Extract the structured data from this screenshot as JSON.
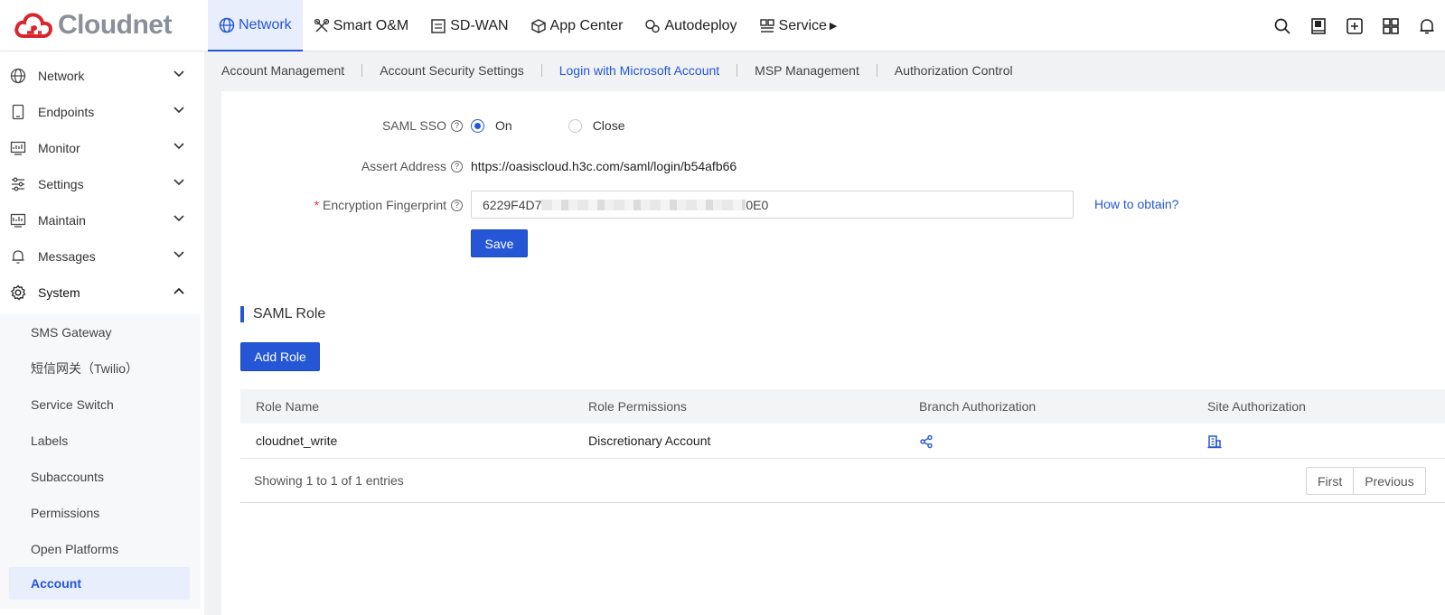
{
  "brand": {
    "name": "Cloudnet",
    "accent": "#2456d6",
    "logo_red": "#d8262d"
  },
  "topnav": {
    "items": [
      {
        "label": "Network",
        "icon": "globe-icon",
        "active": true
      },
      {
        "label": "Smart O&M",
        "icon": "tools-icon"
      },
      {
        "label": "SD-WAN",
        "icon": "sdwan-icon"
      },
      {
        "label": "App Center",
        "icon": "cube-icon"
      },
      {
        "label": "Autodeploy",
        "icon": "gears-icon"
      },
      {
        "label": "Service",
        "icon": "service-icon"
      }
    ],
    "right_icons": [
      "search-icon",
      "book-icon",
      "plus-box-icon",
      "grid-icon",
      "bell-icon"
    ]
  },
  "sidebar": {
    "items": [
      {
        "label": "Network",
        "icon": "globe-icon"
      },
      {
        "label": "Endpoints",
        "icon": "tablet-icon"
      },
      {
        "label": "Monitor",
        "icon": "monitor-icon"
      },
      {
        "label": "Settings",
        "icon": "sliders-icon"
      },
      {
        "label": "Maintain",
        "icon": "maintain-icon"
      },
      {
        "label": "Messages",
        "icon": "bell-icon"
      },
      {
        "label": "System",
        "icon": "gear-icon",
        "open": true
      }
    ],
    "sub_items": [
      {
        "label": "SMS Gateway"
      },
      {
        "label": "短信网关（Twilio）"
      },
      {
        "label": "Service Switch"
      },
      {
        "label": "Labels"
      },
      {
        "label": "Subaccounts"
      },
      {
        "label": "Permissions"
      },
      {
        "label": "Open Platforms"
      },
      {
        "label": "Account",
        "active": true
      }
    ]
  },
  "tabs": [
    {
      "label": "Account Management"
    },
    {
      "label": "Account Security Settings"
    },
    {
      "label": "Login with Microsoft Account",
      "active": true
    },
    {
      "label": "MSP Management"
    },
    {
      "label": "Authorization Control"
    }
  ],
  "form": {
    "saml_sso_label": "SAML SSO",
    "saml_on": "On",
    "saml_close": "Close",
    "assert_address_label": "Assert Address",
    "assert_address_value": "https://oasiscloud.h3c.com/saml/login/b54afb66",
    "fingerprint_label": "Encryption Fingerprint",
    "fingerprint_prefix": "6229F4D7",
    "fingerprint_suffix": "0E0",
    "how_to_obtain": "How to obtain?",
    "save_label": "Save"
  },
  "saml_role": {
    "title": "SAML Role",
    "add_role_label": "Add Role",
    "columns": [
      "Role Name",
      "Role Permissions",
      "Branch Authorization",
      "Site Authorization"
    ],
    "rows": [
      {
        "role_name": "cloudnet_write",
        "role_permissions": "Discretionary Account"
      }
    ],
    "showing": "Showing 1 to 1 of 1 entries",
    "pager": {
      "first": "First",
      "previous": "Previous"
    }
  }
}
